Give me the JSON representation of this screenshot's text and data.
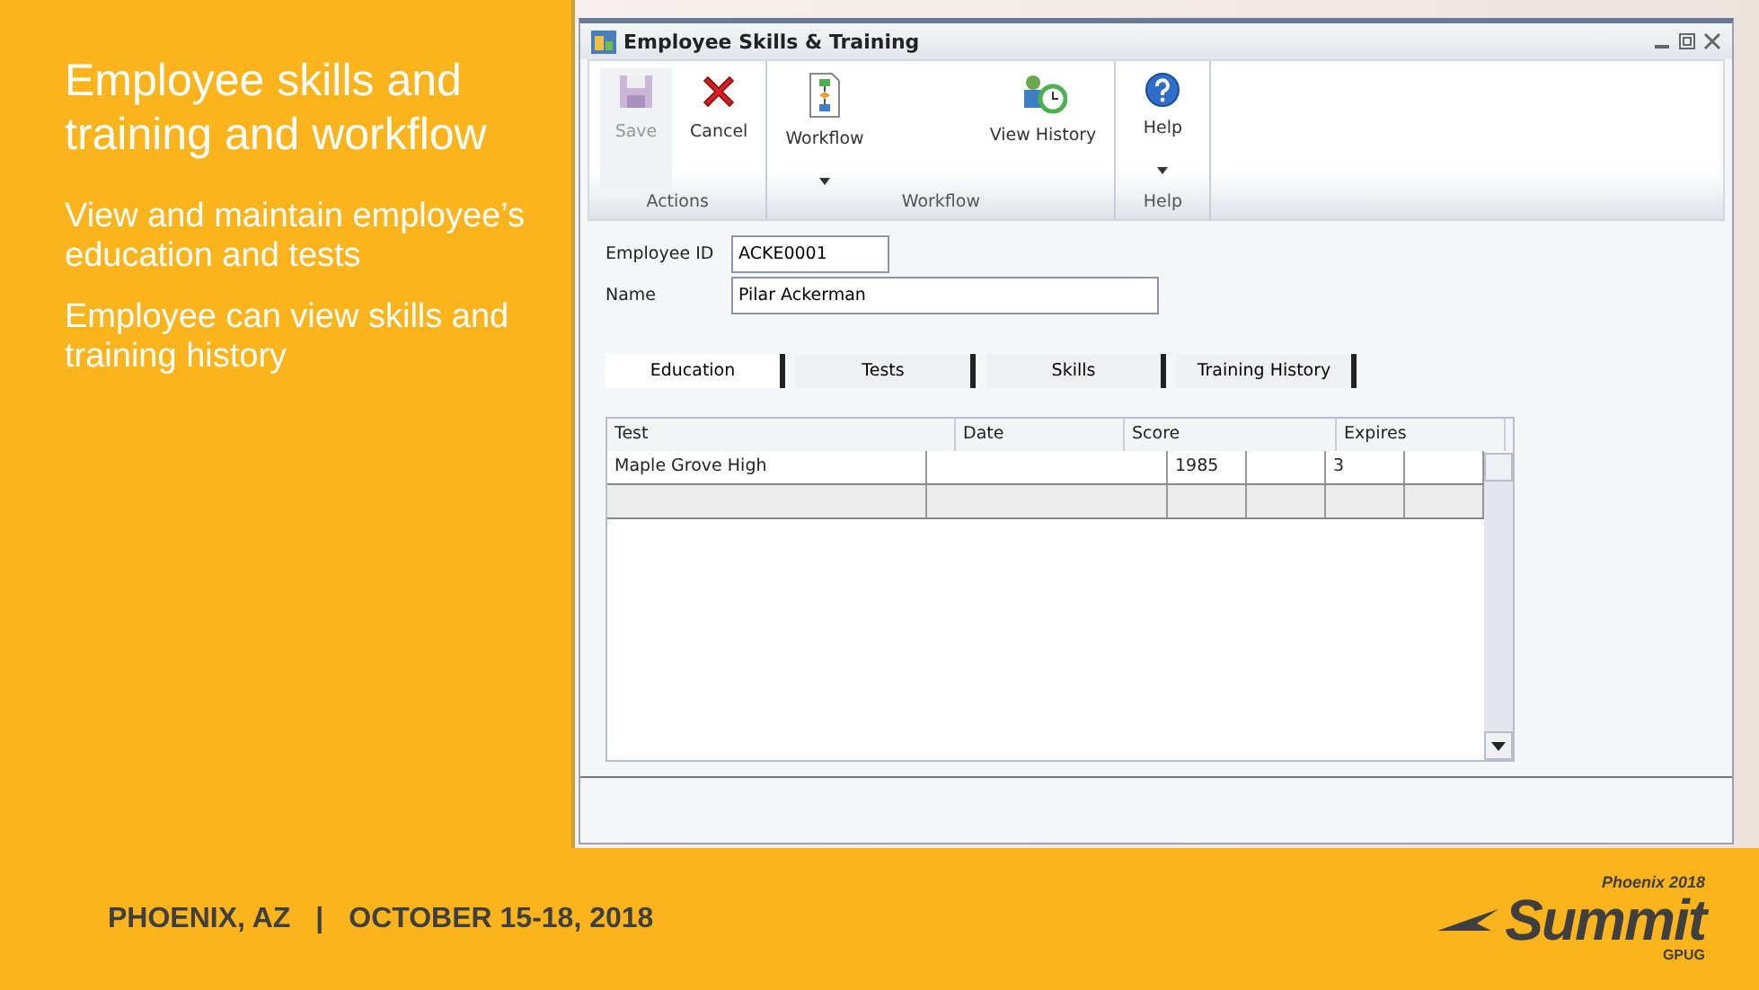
{
  "slide": {
    "title": "Employee skills and training and workflow",
    "points": [
      "View and maintain employee’s education and tests",
      "Employee can view skills and training history"
    ]
  },
  "window": {
    "title": "Employee Skills & Training",
    "ribbon": [
      {
        "label": "Actions",
        "buttons": [
          {
            "label": "Save",
            "kind": "save",
            "disabled": true,
            "dropdown": false
          },
          {
            "label": "Cancel",
            "kind": "cancel",
            "disabled": false,
            "dropdown": false
          }
        ]
      },
      {
        "label": "Workflow",
        "buttons": [
          {
            "label": "Workflow",
            "kind": "workflow",
            "disabled": false,
            "dropdown": true
          },
          {
            "label": "View History",
            "kind": "history",
            "disabled": false,
            "dropdown": false
          }
        ]
      },
      {
        "label": "Help",
        "buttons": [
          {
            "label": "Help",
            "kind": "help",
            "disabled": false,
            "dropdown": true
          }
        ]
      }
    ],
    "fields": [
      {
        "label": "Employee ID",
        "value": "ACKE0001"
      },
      {
        "label": "Name",
        "value": "Pilar Ackerman"
      }
    ],
    "tabs": [
      {
        "label": "Education",
        "selected": true
      },
      {
        "label": "Tests",
        "selected": false
      },
      {
        "label": "Skills",
        "selected": false
      },
      {
        "label": "Training History",
        "selected": false
      }
    ],
    "table": {
      "columns": [
        "Test",
        "Date",
        "Score",
        "Expires"
      ],
      "rows": [
        {
          "selected": true,
          "cells": [
            "Maple Grove High",
            null,
            "1985",
            null,
            "3",
            null
          ]
        },
        {
          "selected": false,
          "cells": [
            null,
            null,
            null,
            null,
            null,
            null
          ]
        }
      ]
    }
  },
  "footer": {
    "location": "PHOENIX, AZ",
    "separator": "|",
    "dates": "OCTOBER 15-18, 2018",
    "logo": {
      "event": "Phoenix 2018",
      "name": "Summit",
      "org": "GPUG"
    }
  }
}
